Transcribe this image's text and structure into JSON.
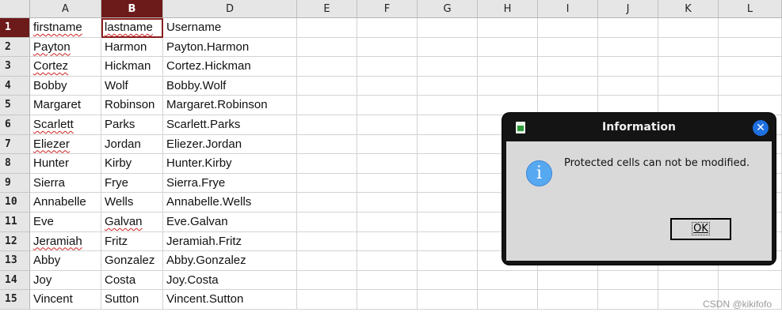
{
  "columns": [
    "A",
    "B",
    "D",
    "E",
    "F",
    "G",
    "H",
    "I",
    "J",
    "K",
    "L"
  ],
  "active_column": "B",
  "row_numbers": [
    "1",
    "2",
    "3",
    "4",
    "5",
    "6",
    "7",
    "8",
    "9",
    "10",
    "11",
    "12",
    "13",
    "14",
    "15"
  ],
  "rows": [
    [
      "firstname",
      "lastname",
      "Username"
    ],
    [
      "Payton",
      "Harmon",
      "Payton.Harmon"
    ],
    [
      "Cortez",
      "Hickman",
      "Cortez.Hickman"
    ],
    [
      "Bobby",
      "Wolf",
      "Bobby.Wolf"
    ],
    [
      "Margaret",
      "Robinson",
      "Margaret.Robinson"
    ],
    [
      "Scarlett",
      "Parks",
      "Scarlett.Parks"
    ],
    [
      "Eliezer",
      "Jordan",
      "Eliezer.Jordan"
    ],
    [
      "Hunter",
      "Kirby",
      "Hunter.Kirby"
    ],
    [
      "Sierra",
      "Frye",
      "Sierra.Frye"
    ],
    [
      "Annabelle",
      "Wells",
      "Annabelle.Wells"
    ],
    [
      "Eve",
      "Galvan",
      "Eve.Galvan"
    ],
    [
      "Jeramiah",
      "Fritz",
      "Jeramiah.Fritz"
    ],
    [
      "Abby",
      "Gonzalez",
      "Abby.Gonzalez"
    ],
    [
      "Joy",
      "Costa",
      "Joy.Costa"
    ],
    [
      "Vincent",
      "Sutton",
      "Vincent.Sutton"
    ]
  ],
  "spellcheck_flagged": [
    "firstname",
    "lastname",
    "Payton",
    "Cortez",
    "Scarlett",
    "Eliezer",
    "Galvan",
    "Jeramiah"
  ],
  "dialog": {
    "title": "Information",
    "message": "Protected cells can not be modified.",
    "ok_label": "OK",
    "app_icon": "spreadsheet-icon",
    "info_icon": "info-icon",
    "close_icon": "close-icon"
  },
  "watermark": "CSDN @kikifofo",
  "colors": {
    "active_header": "#6d1a1a",
    "dialog_frame": "#141414",
    "dialog_body": "#d9d9d9",
    "close_button": "#1e6fe0",
    "info_icon": "#56a8f1"
  }
}
